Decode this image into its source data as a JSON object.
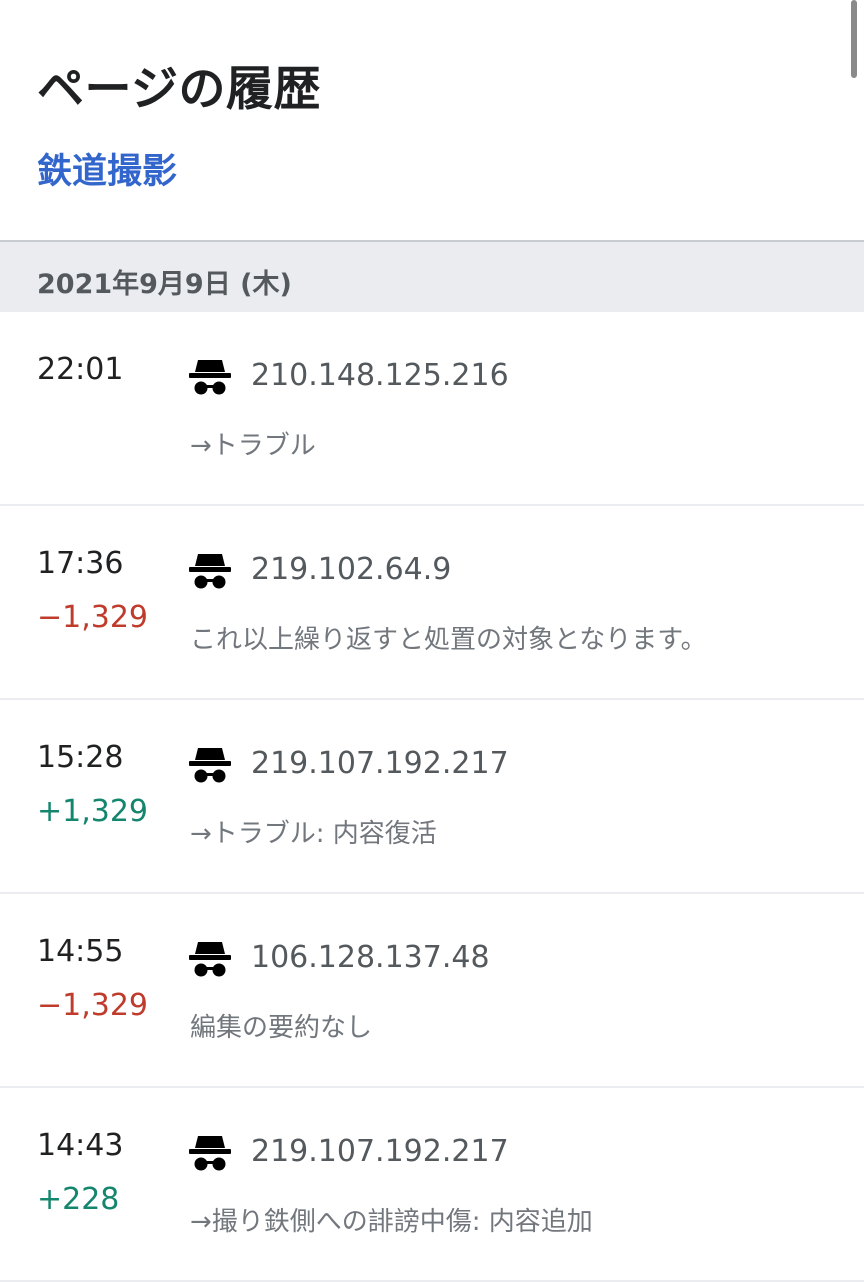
{
  "header": {
    "title": "ページの履歴",
    "page_link": "鉄道撮影"
  },
  "date_section": {
    "label": "2021年9月9日 (木)"
  },
  "revisions": [
    {
      "time": "22:01",
      "diff": "",
      "user": "210.148.125.216",
      "summary": "→トラブル",
      "icon": "anonymous-user-icon"
    },
    {
      "time": "17:36",
      "diff": "−1,329",
      "user": "219.102.64.9",
      "summary": "これ以上繰り返すと処置の対象となります。",
      "icon": "anonymous-user-icon"
    },
    {
      "time": "15:28",
      "diff": "+1,329",
      "user": "219.107.192.217",
      "summary": "→トラブル: 内容復活",
      "icon": "anonymous-user-icon"
    },
    {
      "time": "14:55",
      "diff": "−1,329",
      "user": "106.128.137.48",
      "summary": "編集の要約なし",
      "icon": "anonymous-user-icon"
    },
    {
      "time": "14:43",
      "diff": "+228",
      "user": "219.107.192.217",
      "summary": "→撮り鉄側への誹謗中傷: 内容追加",
      "icon": "anonymous-user-icon"
    }
  ],
  "colors": {
    "link": "#3366cc",
    "negative": "#bf3c2c",
    "positive": "#14866d",
    "date_header_bg": "#eaecf0"
  }
}
